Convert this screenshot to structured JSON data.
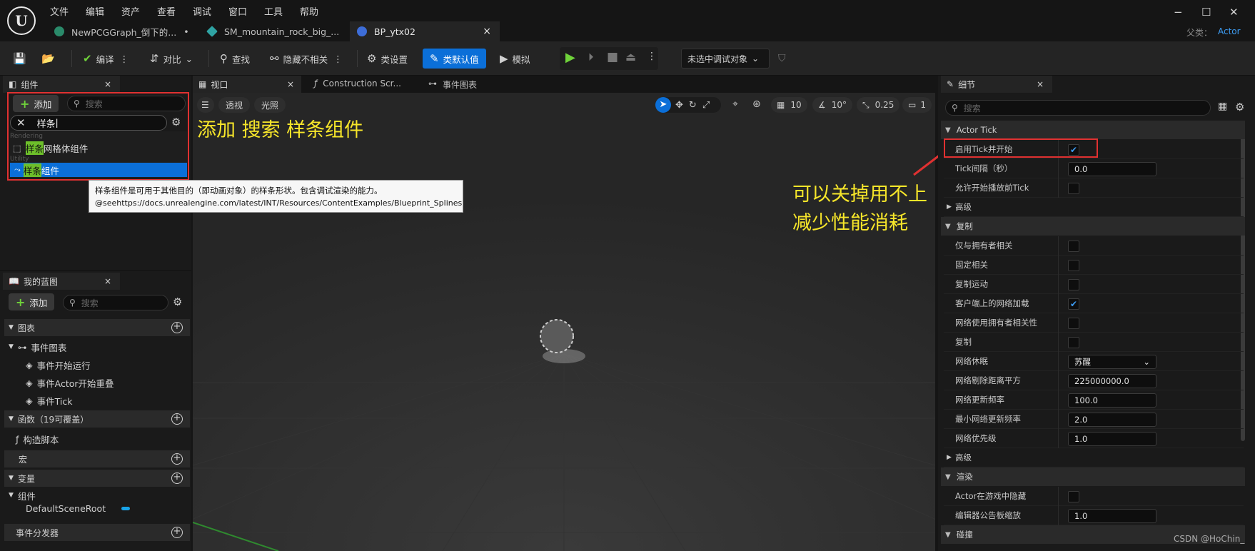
{
  "titlebar": {
    "menu": [
      "文件",
      "编辑",
      "资产",
      "查看",
      "调试",
      "窗口",
      "工具",
      "帮助"
    ],
    "tabs": [
      {
        "label": "NewPCGGraph_倒下的...",
        "dot": "•"
      },
      {
        "label": "SM_mountain_rock_big_..."
      },
      {
        "label": "BP_ytx02",
        "close": "×"
      }
    ],
    "parent_label": "父类：",
    "parent_value": "Actor",
    "window_buttons": [
      "−",
      "☐",
      "✕"
    ]
  },
  "toolbar": {
    "compile": "编译",
    "diff": "对比",
    "find": "查找",
    "hide_unrelated": "隐藏不相关",
    "class_settings": "类设置",
    "class_defaults": "类默认值",
    "simulate": "模拟",
    "debug_target": "未选中调试对象"
  },
  "components_panel": {
    "title": "组件",
    "add_label": "添加",
    "search_placeholder": "搜索",
    "search_value": "样条",
    "cat_rendering": "Rendering",
    "item1_hl": "样条",
    "item1_rest": "网格体组件",
    "cat_utility": "Utility",
    "item2_hl": "样条",
    "item2_rest": "组件",
    "tooltip_line1": "样条组件是可用于其他目的（即动画对象）的样条形状。包含调试渲染的能力。",
    "tooltip_line2": "@seehttps://docs.unrealengine.com/latest/INT/Resources/ContentExamples/Blueprint_Splines"
  },
  "annotations": {
    "left": "添加 搜索 样条组件",
    "right_line1": "可以关掉用不上",
    "right_line2": "减少性能消耗"
  },
  "mybp_panel": {
    "title": "我的蓝图",
    "add_label": "添加",
    "search_placeholder": "搜索",
    "graphs": "图表",
    "event_graph": "事件图表",
    "events": [
      "事件开始运行",
      "事件Actor开始重叠",
      "事件Tick"
    ],
    "functions": "函数（19可覆盖）",
    "construction_script": "构造脚本",
    "macros": "宏",
    "variables": "变量",
    "components": "组件",
    "default_root": "DefaultSceneRoot",
    "dispatchers": "事件分发器"
  },
  "viewport": {
    "tabs": [
      "视口",
      "Construction Scr...",
      "事件图表"
    ],
    "perspective": "透视",
    "lit": "光照",
    "grid_size": "10",
    "angle": "10°",
    "scale": "0.25",
    "cam_speed": "1"
  },
  "details": {
    "title": "细节",
    "search_placeholder": "搜索",
    "cat_actor_tick": "Actor Tick",
    "tick_rows": [
      {
        "label": "启用Tick并开始",
        "type": "check",
        "checked": true
      },
      {
        "label": "Tick间隔（秒）",
        "type": "input",
        "value": "0.0"
      },
      {
        "label": "允许开始播放前Tick",
        "type": "check",
        "checked": false
      }
    ],
    "advanced": "高级",
    "cat_replication": "复制",
    "rep_rows": [
      {
        "label": "仅与拥有者相关",
        "type": "check",
        "checked": false
      },
      {
        "label": "固定相关",
        "type": "check",
        "checked": false
      },
      {
        "label": "复制运动",
        "type": "check",
        "checked": false
      },
      {
        "label": "客户端上的网络加载",
        "type": "check",
        "checked": true
      },
      {
        "label": "网络使用拥有者相关性",
        "type": "check",
        "checked": false
      },
      {
        "label": "复制",
        "type": "check",
        "checked": false
      },
      {
        "label": "网络休眠",
        "type": "select",
        "value": "苏醒"
      },
      {
        "label": "网络剔除距离平方",
        "type": "input",
        "value": "225000000.0"
      },
      {
        "label": "网络更新频率",
        "type": "input",
        "value": "100.0"
      },
      {
        "label": "最小网络更新频率",
        "type": "input",
        "value": "2.0"
      },
      {
        "label": "网络优先级",
        "type": "input",
        "value": "1.0"
      }
    ],
    "advanced2": "高级",
    "cat_rendering": "渲染",
    "render_rows": [
      {
        "label": "Actor在游戏中隐藏",
        "type": "check",
        "checked": false
      },
      {
        "label": "编辑器公告板缩放",
        "type": "input",
        "value": "1.0"
      }
    ],
    "cat_collision": "碰撞"
  },
  "watermark": "CSDN @HoChin_",
  "colors": {
    "accent": "#0b6fd8",
    "highlight": "#6dbf2a",
    "annot": "#f7e62a",
    "red": "#e03131"
  }
}
